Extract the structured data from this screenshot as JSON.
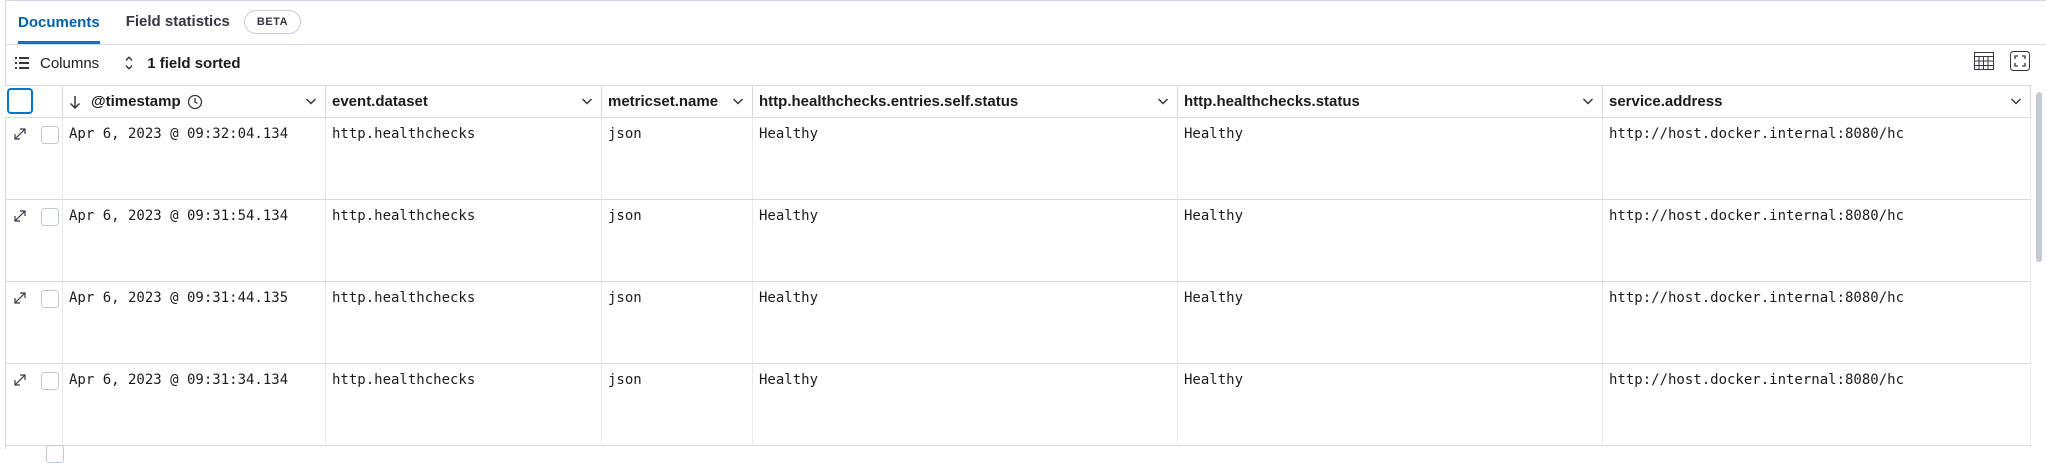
{
  "tabs": [
    {
      "label": "Documents",
      "active": true
    },
    {
      "label": "Field statistics",
      "active": false
    }
  ],
  "beta_badge": "BETA",
  "toolbar": {
    "columns_label": "Columns",
    "sort_label": "1 field sorted"
  },
  "columns": [
    {
      "label": "@timestamp",
      "sorted": "descending"
    },
    {
      "label": "event.dataset"
    },
    {
      "label": "metricset.name"
    },
    {
      "label": "http.healthchecks.entries.self.status"
    },
    {
      "label": "http.healthchecks.status"
    },
    {
      "label": "service.address"
    }
  ],
  "rows": [
    [
      "Apr 6, 2023 @ 09:32:04.134",
      "http.healthchecks",
      "json",
      "Healthy",
      "Healthy",
      "http://host.docker.internal:8080/hc"
    ],
    [
      "Apr 6, 2023 @ 09:31:54.134",
      "http.healthchecks",
      "json",
      "Healthy",
      "Healthy",
      "http://host.docker.internal:8080/hc"
    ],
    [
      "Apr 6, 2023 @ 09:31:44.135",
      "http.healthchecks",
      "json",
      "Healthy",
      "Healthy",
      "http://host.docker.internal:8080/hc"
    ],
    [
      "Apr 6, 2023 @ 09:31:34.134",
      "http.healthchecks",
      "json",
      "Healthy",
      "Healthy",
      "http://host.docker.internal:8080/hc"
    ]
  ],
  "colors": {
    "accent": "#0077cc",
    "border": "#d3dae6"
  }
}
